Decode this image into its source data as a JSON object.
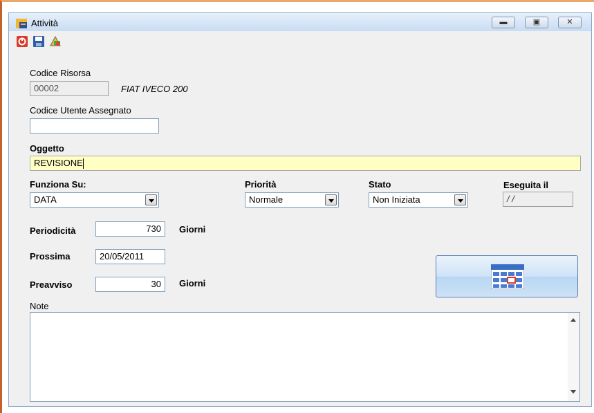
{
  "window": {
    "title": "Attività"
  },
  "toolbar": {
    "icons": [
      "close-red-icon",
      "save-icon",
      "clear-icon"
    ]
  },
  "form": {
    "codice_risorsa": {
      "label": "Codice Risorsa",
      "value": "00002",
      "description": "FIAT IVECO 200"
    },
    "codice_utente": {
      "label": "Codice Utente Assegnato",
      "value": ""
    },
    "oggetto": {
      "label": "Oggetto",
      "value": "REVISIONE"
    },
    "funziona_su": {
      "label": "Funziona Su:",
      "value": "DATA"
    },
    "priorita": {
      "label": "Priorità",
      "value": "Normale"
    },
    "stato": {
      "label": "Stato",
      "value": "Non Iniziata"
    },
    "eseguita_il": {
      "label": "Eseguita il",
      "value": "/ /"
    },
    "periodicita": {
      "label": "Periodicità",
      "value": "730",
      "unit": "Giorni"
    },
    "prossima": {
      "label": "Prossima",
      "value": "20/05/2011"
    },
    "preavviso": {
      "label": "Preavviso",
      "value": "30",
      "unit": "Giorni"
    },
    "note": {
      "label": "Note",
      "value": ""
    }
  },
  "colors": {
    "highlight_field": "#ffffc4",
    "accent_border": "#c4622a"
  }
}
